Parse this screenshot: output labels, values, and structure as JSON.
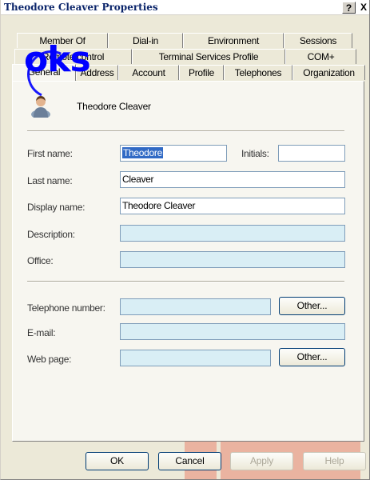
{
  "window": {
    "title": "Theodore Cleaver Properties",
    "help_label": "?",
    "close_label": "X"
  },
  "tabs": {
    "row1": [
      "Member Of",
      "Dial-in",
      "Environment",
      "Sessions"
    ],
    "row2": [
      "Remote control",
      "Terminal Services Profile",
      "COM+"
    ],
    "row3": [
      "General",
      "Address",
      "Account",
      "Profile",
      "Telephones",
      "Organization"
    ],
    "active": "General"
  },
  "watermark": {
    "text": "oks"
  },
  "general": {
    "user_display": "Theodore Cleaver",
    "first_name_label": "First name:",
    "first_name_value": "Theodore",
    "initials_label": "Initials:",
    "initials_value": "",
    "last_name_label": "Last name:",
    "last_name_value": "Cleaver",
    "display_name_label": "Display name:",
    "display_name_value": "Theodore Cleaver",
    "description_label": "Description:",
    "description_value": "",
    "office_label": "Office:",
    "office_value": "",
    "telephone_label": "Telephone number:",
    "telephone_value": "",
    "email_label": "E-mail:",
    "email_value": "",
    "webpage_label": "Web page:",
    "webpage_value": "",
    "other_label": "Other..."
  },
  "buttons": {
    "ok": "OK",
    "cancel": "Cancel",
    "apply": "Apply",
    "help": "Help"
  },
  "colors": {
    "title_text": "#0a246a",
    "readonly_field": "#d9eef5",
    "selection": "#316ac5",
    "watermark": "#0000ff"
  }
}
